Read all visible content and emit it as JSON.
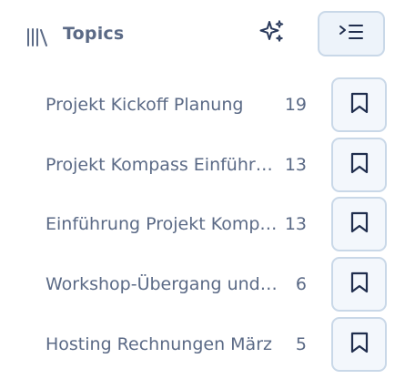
{
  "header": {
    "title": "Topics",
    "library_icon": "library-icon",
    "sparkle_icon": "sparkle-icon",
    "collapse_icon": "collapse-sidebar-icon"
  },
  "topics": [
    {
      "name": "Projekt Kickoff Planung",
      "count": "19"
    },
    {
      "name": "Projekt Kompass Einführung",
      "count": "13"
    },
    {
      "name": "Einführung Projekt Kompass",
      "count": "13"
    },
    {
      "name": "Workshop-Übergang und Planung",
      "count": "6"
    },
    {
      "name": "Hosting Rechnungen März",
      "count": "5"
    }
  ],
  "bookmark_icon": "bookmark-icon",
  "colors": {
    "text": "#5b6a86",
    "icon": "#1f2d4d",
    "button_bg": "#edf3fa",
    "button_border": "#c9d8e8",
    "sparkle": "#2a3a5c"
  }
}
